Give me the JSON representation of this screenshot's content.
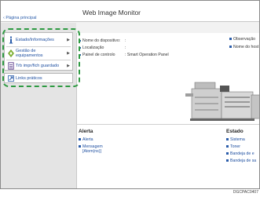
{
  "app_title": "Web Image Monitor",
  "breadcrumb": "‹ Página principal",
  "menu": {
    "items": [
      {
        "label": "Estado/Informações",
        "icon": "info-icon"
      },
      {
        "label_line1": "Gestão de",
        "label_line2": "equipamentos",
        "icon": "device-management-icon"
      },
      {
        "label": "Trb impr/fich guardado",
        "icon": "stored-job-icon"
      }
    ],
    "links": {
      "label": "Links práticos",
      "icon": "link-icon"
    }
  },
  "device_info": {
    "name_label": "Nome do dispositivo:",
    "name_value": ":",
    "location_label": "Localização",
    "location_value": ":",
    "panel_label": "Painel de controlo",
    "panel_value": ": Smart Operation Panel"
  },
  "right_info": {
    "observation": "Observação",
    "host_name": "Nome do host"
  },
  "alert": {
    "title": "Alerta",
    "items": [
      "Alerta",
      "Mensagem",
      "[Atom(ns)]"
    ]
  },
  "status": {
    "title": "Estado",
    "items": [
      "Sistema",
      "Toner",
      "Bandeja de e",
      "Bandeja de sa"
    ]
  },
  "figure_code": "DGCPAC0407",
  "colors": {
    "link": "#1e4fa0",
    "highlight": "#2e9a42",
    "accent": "#2a5caa"
  }
}
